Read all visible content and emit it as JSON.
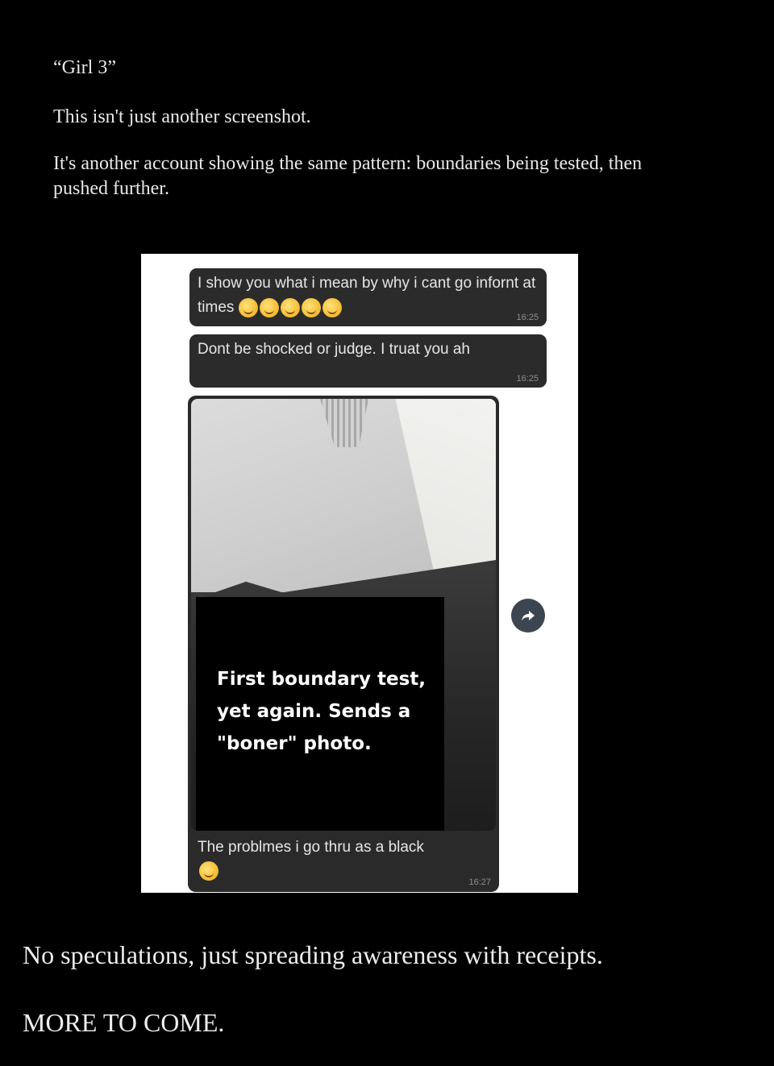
{
  "intro": {
    "title": "“Girl 3”",
    "line1": "This isn't just another screenshot.",
    "para": "It's another account showing the same pattern: boundaries being tested, then pushed further."
  },
  "chat": {
    "messages": [
      {
        "text": "I show you what i mean by why i cant go infornt at times",
        "emoji_count": 5,
        "time": "16:25"
      },
      {
        "text": "Dont be shocked or judge. I truat you ah",
        "time": "16:25"
      },
      {
        "type": "image",
        "overlay_caption": "First boundary test, yet again. Sends a \"boner\" photo.",
        "text": "The problmes i go thru as a black",
        "emoji_count": 1,
        "time": "16:27"
      }
    ],
    "forward_icon": "share-forward-icon"
  },
  "outro": {
    "line1": "No speculations, just spreading awareness with receipts.",
    "line2": "MORE TO COME."
  },
  "colors": {
    "background": "#000000",
    "panel": "#ffffff",
    "bubble": "#2b2b2b",
    "text": "#e9e9e9"
  }
}
